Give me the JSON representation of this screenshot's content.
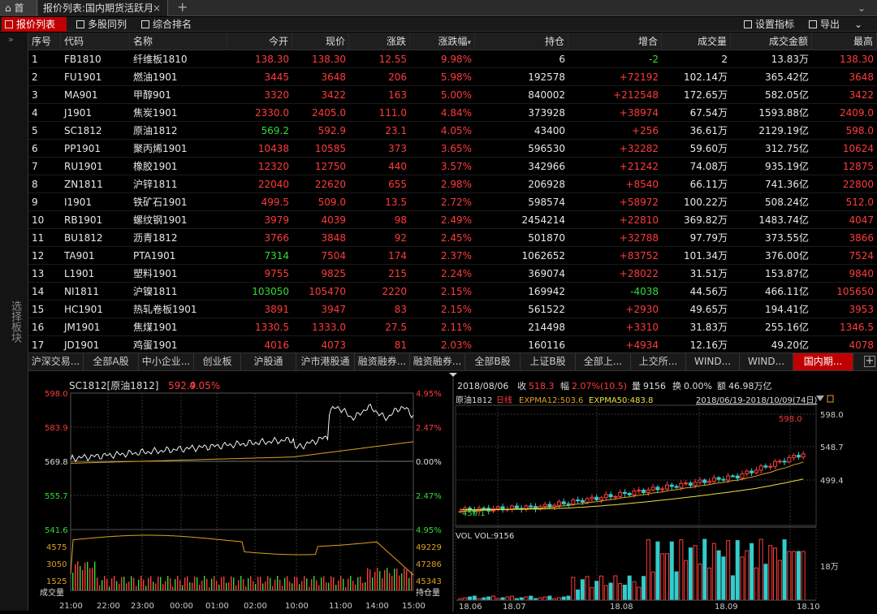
{
  "tabs": {
    "home": "首页",
    "quote": "报价列表:国内期货活跃月",
    "close": "×",
    "plus": "+",
    "chev": "⌄"
  },
  "toolbar": {
    "list": "报价列表",
    "multi": "多股同列",
    "rank": "综合排名",
    "settings": "设置指标",
    "export": "导出",
    "down": "⌄"
  },
  "sidebar": {
    "toggle": "»",
    "label": "选择板块"
  },
  "columns": [
    "序号",
    "代码",
    "名称",
    "今开",
    "现价",
    "涨跌",
    "涨跌幅",
    "持仓",
    "增合",
    "成交量",
    "成交金额",
    "最高"
  ],
  "sort_marker": "▾",
  "rows": [
    [
      "1",
      "FB1810",
      "纤维板1810",
      "138.30",
      "138.30",
      "12.55",
      "9.98%",
      "6",
      "-2",
      "2",
      "13.83万",
      "138.30"
    ],
    [
      "2",
      "FU1901",
      "燃油1901",
      "3445",
      "3648",
      "206",
      "5.98%",
      "192578",
      "+72192",
      "102.14万",
      "365.42亿",
      "3648"
    ],
    [
      "3",
      "MA901",
      "甲醇901",
      "3320",
      "3422",
      "163",
      "5.00%",
      "840002",
      "+212548",
      "172.65万",
      "582.05亿",
      "3422"
    ],
    [
      "4",
      "J1901",
      "焦炭1901",
      "2330.0",
      "2405.0",
      "111.0",
      "4.84%",
      "373928",
      "+38974",
      "67.54万",
      "1593.88亿",
      "2409.0"
    ],
    [
      "5",
      "SC1812",
      "原油1812",
      "569.2",
      "592.9",
      "23.1",
      "4.05%",
      "43400",
      "+256",
      "36.61万",
      "2129.19亿",
      "598.0"
    ],
    [
      "6",
      "PP1901",
      "聚丙烯1901",
      "10438",
      "10585",
      "373",
      "3.65%",
      "596530",
      "+32282",
      "59.60万",
      "312.75亿",
      "10624"
    ],
    [
      "7",
      "RU1901",
      "橡胶1901",
      "12320",
      "12750",
      "440",
      "3.57%",
      "342966",
      "+21242",
      "74.08万",
      "935.19亿",
      "12875"
    ],
    [
      "8",
      "ZN1811",
      "沪锌1811",
      "22040",
      "22620",
      "655",
      "2.98%",
      "206928",
      "+8540",
      "66.11万",
      "741.36亿",
      "22800"
    ],
    [
      "9",
      "I1901",
      "铁矿石1901",
      "499.5",
      "509.0",
      "13.5",
      "2.72%",
      "598574",
      "+58972",
      "100.22万",
      "508.24亿",
      "512.0"
    ],
    [
      "10",
      "RB1901",
      "螺纹钢1901",
      "3979",
      "4039",
      "98",
      "2.49%",
      "2454214",
      "+22810",
      "369.82万",
      "1483.74亿",
      "4047"
    ],
    [
      "11",
      "BU1812",
      "沥青1812",
      "3766",
      "3848",
      "92",
      "2.45%",
      "501870",
      "+32788",
      "97.79万",
      "373.55亿",
      "3866"
    ],
    [
      "12",
      "TA901",
      "PTA1901",
      "7314",
      "7504",
      "174",
      "2.37%",
      "1062652",
      "+83752",
      "101.34万",
      "376.00亿",
      "7524"
    ],
    [
      "13",
      "L1901",
      "塑料1901",
      "9755",
      "9825",
      "215",
      "2.24%",
      "369074",
      "+28022",
      "31.51万",
      "153.87亿",
      "9840"
    ],
    [
      "14",
      "NI1811",
      "沪镍1811",
      "103050",
      "105470",
      "2220",
      "2.15%",
      "169942",
      "-4038",
      "44.56万",
      "466.11亿",
      "105650"
    ],
    [
      "15",
      "HC1901",
      "热轧卷板1901",
      "3891",
      "3947",
      "83",
      "2.15%",
      "561522",
      "+2930",
      "49.65万",
      "194.41亿",
      "3953"
    ],
    [
      "16",
      "JM1901",
      "焦煤1901",
      "1330.5",
      "1333.0",
      "27.5",
      "2.11%",
      "214498",
      "+3310",
      "31.83万",
      "255.16亿",
      "1346.5"
    ],
    [
      "17",
      "JD1901",
      "鸡蛋1901",
      "4016",
      "4073",
      "81",
      "2.03%",
      "160116",
      "+4934",
      "12.16万",
      "49.20亿",
      "4078"
    ]
  ],
  "sectors": [
    "沪深交易...",
    "全部A股",
    "中小企业...",
    "创业板",
    "沪股通",
    "沪市港股通",
    "融资融券...",
    "融资融券...",
    "全部B股",
    "上证B股",
    "全部上...",
    "上交所...",
    "WIND...",
    "WIND...",
    "国内期..."
  ],
  "sector_add": "+",
  "intraday": {
    "title": "SC1812[原油1812]",
    "price": "592.9",
    "pct": "4.05%",
    "price_ticks": [
      "598.0",
      "583.9",
      "569.8",
      "555.7",
      "541.6"
    ],
    "pct_ticks": [
      "4.95%",
      "2.47%",
      "0.00%",
      "2.47%",
      "4.95%"
    ],
    "vol_ticks": [
      "4575",
      "3050",
      "1525"
    ],
    "oi_ticks": [
      "49229",
      "47286",
      "45343"
    ],
    "vol_label": "成交量",
    "oi_label": "持仓量",
    "times": [
      "21:00",
      "22:00",
      "23:00",
      "00:00",
      "01:00",
      "02:00",
      "10:00",
      "11:00",
      "14:00",
      "15:00"
    ]
  },
  "kline": {
    "date": "2018/08/06",
    "close_label": "收",
    "close": "518.3",
    "amp_label": "幅",
    "amp": "2.07%(10.5)",
    "vol_label": "量",
    "vol": "9156",
    "turn_label": "换",
    "turn": "0.00%",
    "amt_label": "额",
    "amt": "46.98万亿",
    "name": "原油1812",
    "period": "日线",
    "ema12": "EXPMA12:503.6",
    "ema50": "EXPMA50:483.8",
    "range": "2018/06/19-2018/10/09(74日)",
    "price_ticks": [
      "598.0",
      "548.7",
      "499.4"
    ],
    "high_mark": "598.0",
    "low_mark": "450.1",
    "vol_title": "VOL VOL:9156",
    "vol_tick": "18万",
    "dates": [
      "18.06",
      "18.07",
      "18.08",
      "18.09",
      "18.10"
    ]
  }
}
